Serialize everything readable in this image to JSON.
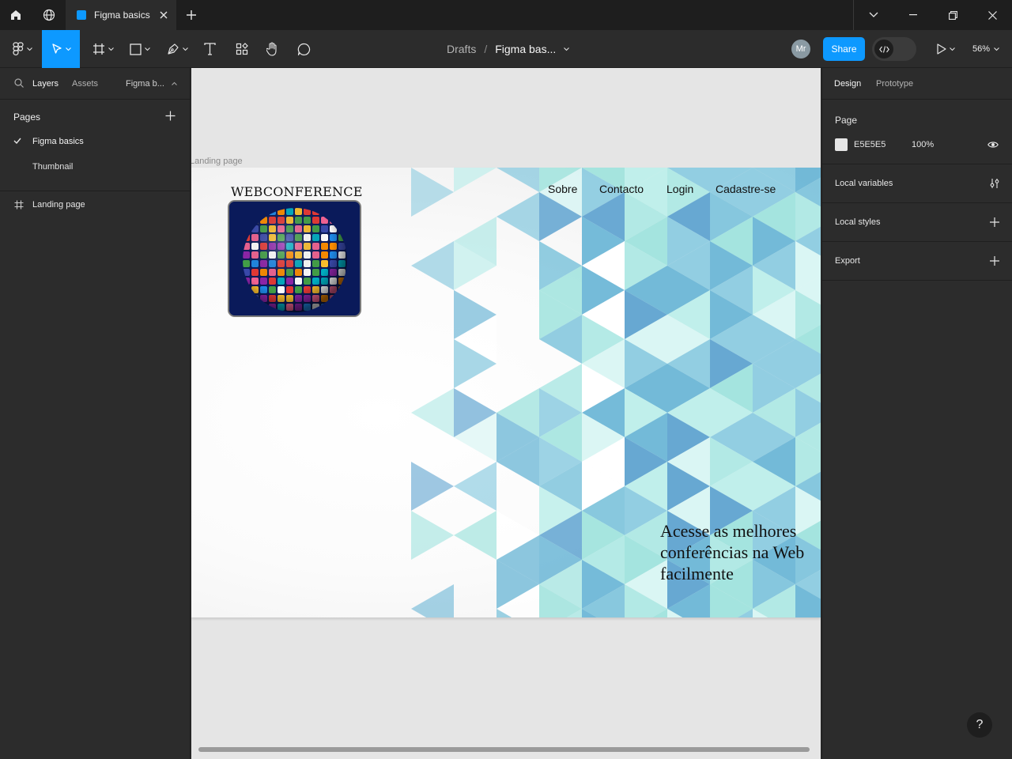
{
  "titlebar": {
    "tab_title": "Figma basics"
  },
  "toolbar": {
    "breadcrumb_parent": "Drafts",
    "breadcrumb_sep": "/",
    "file_name": "Figma bas...",
    "avatar_initials": "Mr",
    "share_label": "Share",
    "zoom": "56%"
  },
  "left_panel": {
    "tabs": [
      "Layers",
      "Assets"
    ],
    "file_dropdown": "Figma b...",
    "pages_header": "Pages",
    "pages": [
      {
        "label": "Figma basics",
        "selected": true
      },
      {
        "label": "Thumbnail",
        "selected": false
      }
    ],
    "layers": [
      {
        "label": "Landing page",
        "icon": "frame-icon"
      }
    ]
  },
  "right_panel": {
    "tabs": [
      "Design",
      "Prototype"
    ],
    "page_section": "Page",
    "page_color": "E5E5E5",
    "page_opacity": "100%",
    "local_variables": "Local variables",
    "local_styles": "Local styles",
    "export": "Export",
    "help": "?"
  },
  "canvas": {
    "frame_label": "Landing page",
    "logo_text": "WEBCONFERENCE",
    "nav": [
      "Sobre",
      "Contacto",
      "Login",
      "Cadastre-se"
    ],
    "hero_lines": [
      "Acesse as melhores",
      "conferências na Web",
      "facilmente"
    ]
  },
  "colors": {
    "accent": "#0d99ff",
    "canvas_bg": "#e5e5e5",
    "panel_bg": "#2c2c2c",
    "titlebar_bg": "#1e1e1e"
  }
}
